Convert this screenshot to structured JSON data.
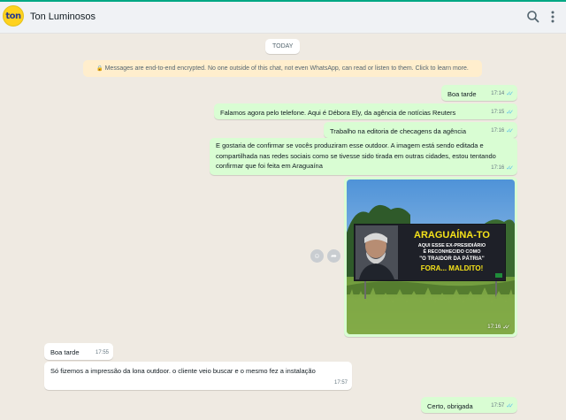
{
  "header": {
    "avatar_text": "ton",
    "contact_name": "Ton Luminosos",
    "search_icon": "search-icon",
    "menu_icon": "more-vertical-icon"
  },
  "chat": {
    "date_chip": "TODAY",
    "encryption_notice": "Messages are end-to-end encrypted. No one outside of this chat, not even WhatsApp, can read or listen to them. Click to learn more.",
    "messages": [
      {
        "dir": "out",
        "text": "Boa tarde",
        "time": "17:14"
      },
      {
        "dir": "out",
        "text": "Falamos agora pelo telefone. Aqui é Débora Ely, da agência de notícias Reuters",
        "time": "17:15"
      },
      {
        "dir": "out",
        "text": "Trabalho na editoria de checagens da agência",
        "time": "17:16"
      },
      {
        "dir": "out",
        "text": "E gostaria de confirmar se vocês produziram esse outdoor. A imagem está sendo editada e compartilhada nas redes sociais como se tivesse sido tirada em outras cidades, estou tentando confirmar que foi feita em Araguaína",
        "time": "17:16"
      },
      {
        "dir": "out",
        "type": "image",
        "time": "17:16",
        "billboard": {
          "line1": "ARAGUAÍNA-TO",
          "line2": "AQUI ESSE EX-PRESIDIÁRIO",
          "line3": "É RECONHECIDO COMO",
          "line4": "\"O TRAIDOR DA PÁTRIA\"",
          "line5": "FORA... MALDITO!"
        }
      },
      {
        "dir": "in",
        "text": "Boa tarde",
        "time": "17:55"
      },
      {
        "dir": "in",
        "text": "Só fizemos a impressão da lona outdoor. o cliente veio buscar e o mesmo fez a instalação",
        "time": "17:57"
      },
      {
        "dir": "out",
        "text": "Certo, obrigada",
        "time": "17:57"
      }
    ]
  },
  "colors": {
    "accent": "#00a884",
    "outgoing_bubble": "#d9fdd3",
    "incoming_bubble": "#ffffff",
    "read_ticks": "#53bdeb",
    "chat_background": "#efeae2",
    "encryption_notice_bg": "#ffeecd"
  }
}
